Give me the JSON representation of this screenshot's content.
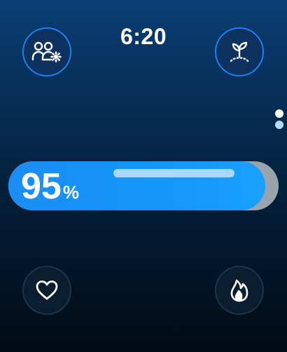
{
  "status": {
    "time": "6:20"
  },
  "buttons": {
    "top_left": {
      "icon": "group-settings-icon"
    },
    "top_right": {
      "icon": "sprout-icon"
    },
    "bottom_left": {
      "icon": "heart-icon"
    },
    "bottom_right": {
      "icon": "flame-icon"
    }
  },
  "level": {
    "value": "95",
    "unit": "%",
    "fill_fraction": 0.95
  },
  "pagination": {
    "pages": 2,
    "active_index": 0
  },
  "colors": {
    "accent": "#1a8ef5",
    "accent_border": "#1f7ff0",
    "background_top": "#0a3f74",
    "background_bottom": "#010b15"
  }
}
